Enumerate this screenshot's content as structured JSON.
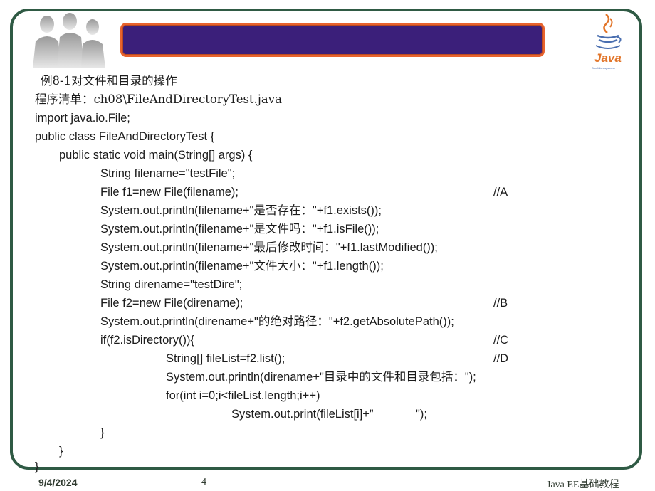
{
  "header": {
    "banner_color": "#3b1f7a",
    "banner_border": "#e8632d",
    "logo_text": "Java",
    "logo_tagline": "Sun Microsystems"
  },
  "code": {
    "title": "例8-1对文件和目录的操作",
    "listing": "程序清单：ch08\\FileAndDirectoryTest.java",
    "l1": "import java.io.File;",
    "l2": "public class FileAndDirectoryTest {",
    "l3": "public static void main(String[] args) {",
    "l4": "String filename=\"testFile\";",
    "l5": "File f1=new File(filename);",
    "l5c": "//A",
    "l6": "System.out.println(filename+\"是否存在：\"+f1.exists());",
    "l7": "System.out.println(filename+\"是文件吗：\"+f1.isFile());",
    "l8": "System.out.println(filename+\"最后修改时间：\"+f1.lastModified());",
    "l9": "System.out.println(filename+\"文件大小：\"+f1.length());",
    "l10": "String direname=\"testDire\";",
    "l11": "File f2=new File(direname);",
    "l11c": "//B",
    "l12": "System.out.println(direname+\"的绝对路径：\"+f2.getAbsolutePath());",
    "l13": "if(f2.isDirectory()){",
    "l13c": "//C",
    "l14": "String[] fileList=f2.list();",
    "l14c": "//D",
    "l15": "System.out.println(direname+\"目录中的文件和目录包括：\");",
    "l16": "for(int i=0;i<fileList.length;i++)",
    "l17": "System.out.print(fileList[i]+”             \");",
    "l18": "}",
    "l19": "}",
    "l20": "}"
  },
  "footer": {
    "date": "9/4/2024",
    "page": "4",
    "course": "Java EE基础教程"
  }
}
